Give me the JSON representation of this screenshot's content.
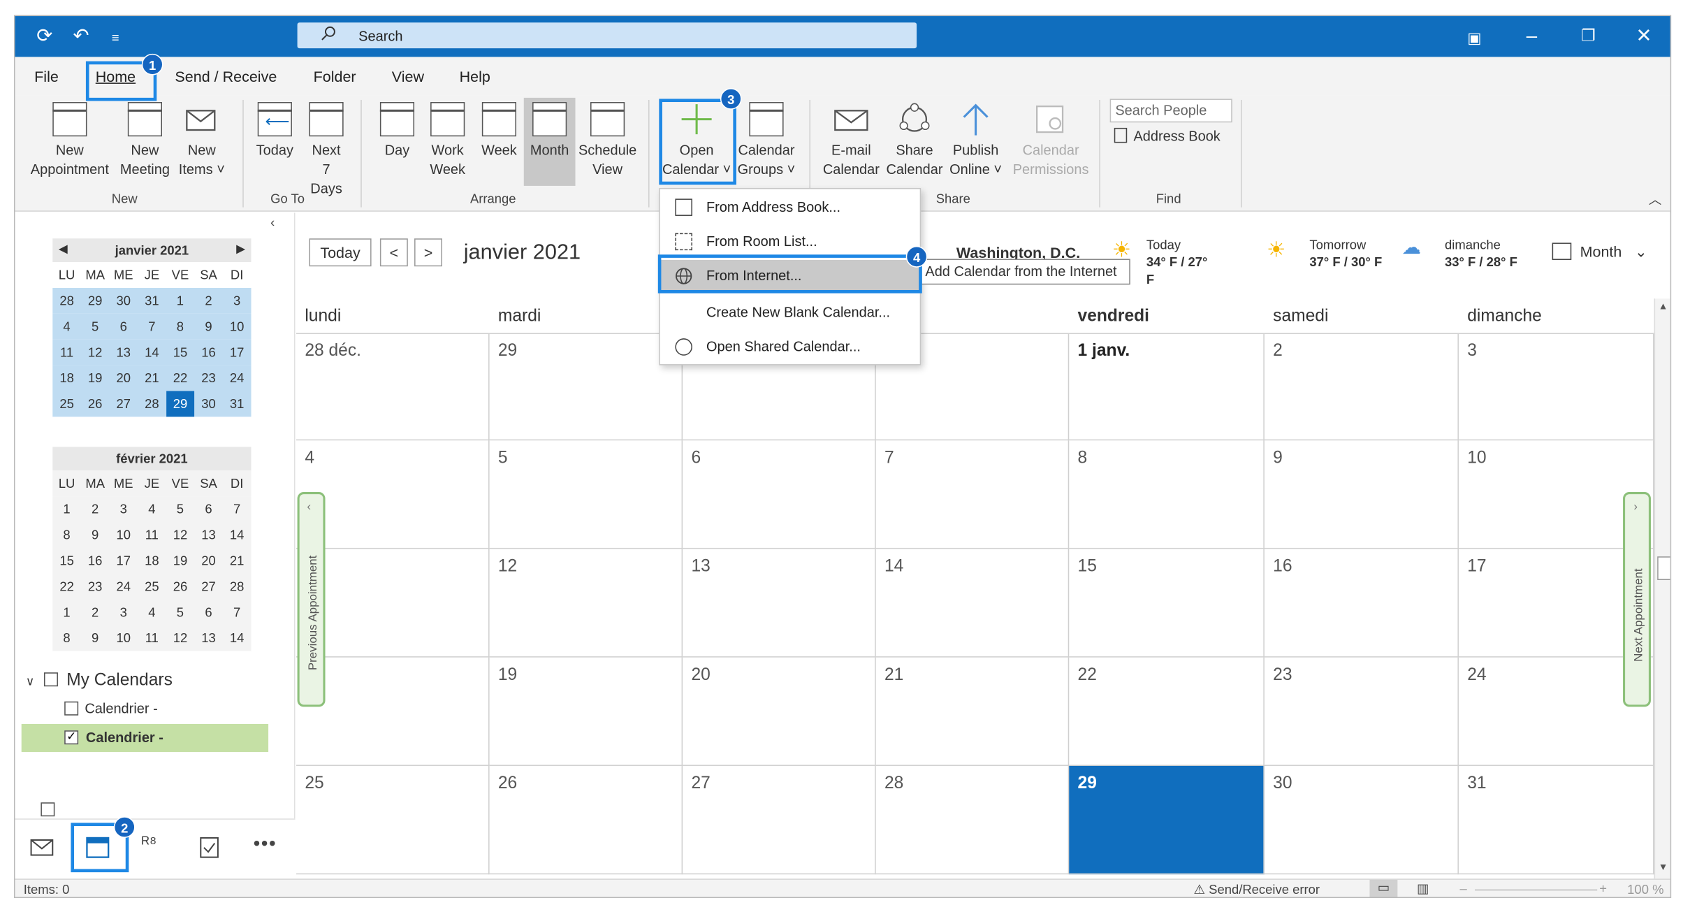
{
  "window": {
    "search_placeholder": "Search"
  },
  "menu": {
    "file": "File",
    "home": "Home",
    "send_receive": "Send / Receive",
    "folder": "Folder",
    "view": "View",
    "help": "Help"
  },
  "ribbon": {
    "new_appointment": [
      "New",
      "Appointment"
    ],
    "new_meeting": [
      "New",
      "Meeting"
    ],
    "new_items": [
      "New",
      "Items ˅"
    ],
    "today": [
      "Today"
    ],
    "next7": [
      "Next",
      "7 Days"
    ],
    "day": [
      "Day"
    ],
    "work_week": [
      "Work",
      "Week"
    ],
    "week": [
      "Week"
    ],
    "month": [
      "Month"
    ],
    "schedule": [
      "Schedule",
      "View"
    ],
    "open_calendar": [
      "Open",
      "Calendar ˅"
    ],
    "calendar_groups": [
      "Calendar",
      "Groups ˅"
    ],
    "email_calendar": [
      "E-mail",
      "Calendar"
    ],
    "share_calendar": [
      "Share",
      "Calendar"
    ],
    "publish_online": [
      "Publish",
      "Online ˅"
    ],
    "calendar_permissions": [
      "Calendar",
      "Permissions"
    ],
    "search_people": "Search People",
    "address_book": "Address Book",
    "groups": {
      "new": "New",
      "goto": "Go To",
      "arrange": "Arrange",
      "share": "Share",
      "find": "Find"
    }
  },
  "annotations": [
    "1",
    "2",
    "3",
    "4"
  ],
  "dropdown": {
    "items": [
      "From Address Book...",
      "From Room List...",
      "From Internet...",
      "Create New Blank Calendar...",
      "Open Shared Calendar..."
    ],
    "tooltip": "Add Calendar from the Internet"
  },
  "mini1": {
    "title": "janvier 2021",
    "dow": [
      "LU",
      "MA",
      "ME",
      "JE",
      "VE",
      "SA",
      "DI"
    ],
    "weeks": [
      [
        "28",
        "29",
        "30",
        "31",
        "1",
        "2",
        "3"
      ],
      [
        "4",
        "5",
        "6",
        "7",
        "8",
        "9",
        "10"
      ],
      [
        "11",
        "12",
        "13",
        "14",
        "15",
        "16",
        "17"
      ],
      [
        "18",
        "19",
        "20",
        "21",
        "22",
        "23",
        "24"
      ],
      [
        "25",
        "26",
        "27",
        "28",
        "29",
        "30",
        "31"
      ]
    ]
  },
  "mini2": {
    "title": "février 2021",
    "dow": [
      "LU",
      "MA",
      "ME",
      "JE",
      "VE",
      "SA",
      "DI"
    ],
    "weeks": [
      [
        "1",
        "2",
        "3",
        "4",
        "5",
        "6",
        "7"
      ],
      [
        "8",
        "9",
        "10",
        "11",
        "12",
        "13",
        "14"
      ],
      [
        "15",
        "16",
        "17",
        "18",
        "19",
        "20",
        "21"
      ],
      [
        "22",
        "23",
        "24",
        "25",
        "26",
        "27",
        "28"
      ],
      [
        "1",
        "2",
        "3",
        "4",
        "5",
        "6",
        "7"
      ],
      [
        "8",
        "9",
        "10",
        "11",
        "12",
        "13",
        "14"
      ]
    ]
  },
  "calendars": {
    "section": "My Calendars",
    "items": [
      "Calendrier -",
      "Calendrier -"
    ]
  },
  "main": {
    "today_btn": "Today",
    "month_title": "janvier 2021",
    "location": "Washington, D.C.",
    "weather": [
      {
        "day": "Today",
        "temp": "34° F / 27° F"
      },
      {
        "day": "Tomorrow",
        "temp": "37° F / 30° F"
      },
      {
        "day": "dimanche",
        "temp": "33° F / 28° F"
      }
    ],
    "view_select": "Month",
    "days": [
      "lundi",
      "mardi",
      "",
      "",
      "vendredi",
      "samedi",
      "dimanche"
    ],
    "rows": [
      [
        "28 déc.",
        "29",
        "",
        "",
        "1 janv.",
        "2",
        "3"
      ],
      [
        "4",
        "5",
        "6",
        "7",
        "8",
        "9",
        "10"
      ],
      [
        "",
        "12",
        "13",
        "14",
        "15",
        "16",
        "17"
      ],
      [
        "",
        "19",
        "20",
        "21",
        "22",
        "23",
        "24"
      ],
      [
        "25",
        "26",
        "27",
        "28",
        "29",
        "30",
        "31"
      ]
    ],
    "prev_appt": "Previous Appointment",
    "next_appt": "Next Appointment"
  },
  "status": {
    "items": "Items: 0",
    "error": "Send/Receive error",
    "zoom": "100 %"
  },
  "colors": {
    "accent": "#106ebe",
    "annotation": "#1e88e5",
    "highlight": "#bfdcf2",
    "calendar_green": "#c5e0a5"
  }
}
